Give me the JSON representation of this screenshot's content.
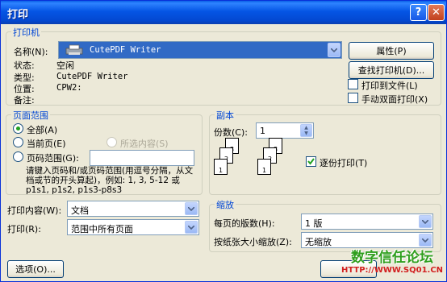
{
  "window": {
    "title": "打印",
    "help": "?",
    "close": "✕"
  },
  "printer": {
    "group_title": "打印机",
    "name_label": "名称(N):",
    "name_value": "CutePDF Writer",
    "status_label": "状态:",
    "status_value": "空闲",
    "type_label": "类型:",
    "type_value": "CutePDF Writer",
    "location_label": "位置:",
    "location_value": "CPW2:",
    "comment_label": "备注:",
    "comment_value": "",
    "properties_button": "属性(P)",
    "find_printer_button": "查找打印机(D)...",
    "print_to_file": "打印到文件(L)",
    "manual_duplex": "手动双面打印(X)"
  },
  "page_range": {
    "group_title": "页面范围",
    "all": "全部(A)",
    "current": "当前页(E)",
    "selection": "所选内容(S)",
    "pages": "页码范围(G):",
    "pages_value": "",
    "hint": "请键入页码和/或页码范围(用逗号分隔，从文档或节的开头算起)，例如: 1, 3, 5-12 或 p1s1, p1s2, p1s3-p8s3",
    "selected": "all"
  },
  "copies": {
    "group_title": "副本",
    "count_label": "份数(C):",
    "count_value": "1",
    "collate": "逐份打印(T)",
    "collate_checked": true
  },
  "print_what": {
    "label": "打印内容(W):",
    "value": "文档"
  },
  "print_which": {
    "label": "打印(R):",
    "value": "范围中所有页面"
  },
  "zoom": {
    "group_title": "缩放",
    "pages_per_sheet_label": "每页的版数(H):",
    "pages_per_sheet_value": "1 版",
    "scale_label": "按纸张大小缩放(Z):",
    "scale_value": "无缩放"
  },
  "options_button": "选项(O)...",
  "watermark": {
    "line1": "数字信任论坛",
    "line2": "HTTP://WWW.SQ01.CN"
  }
}
